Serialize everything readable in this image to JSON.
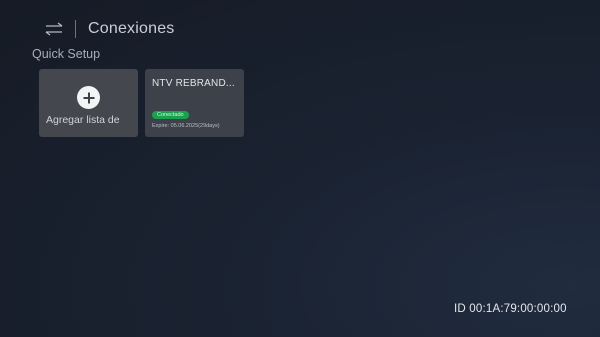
{
  "header": {
    "icon": "swap-arrows-icon",
    "title": "Conexiones"
  },
  "quick_setup": {
    "title": "Quick Setup",
    "add_tile": {
      "icon": "plus-icon",
      "label": "Agregar lista de"
    },
    "connections": [
      {
        "name": "NTV REBRAND...",
        "status": "Conectado",
        "expire": "Expire: 05.06.2025(29days)"
      }
    ]
  },
  "footer": {
    "device_id": "ID 00:1A:79:00:00:00"
  },
  "colors": {
    "status_connected": "#1aa14e",
    "background": "#1a2231"
  }
}
